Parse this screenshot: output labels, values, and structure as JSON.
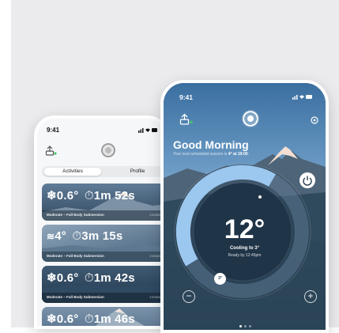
{
  "back_phone": {
    "status_time": "9:41",
    "tabs": [
      "Activities",
      "Profile"
    ],
    "cards": [
      {
        "value_temp": "0.6°",
        "value_time": "1m 52s",
        "subtitle": "Moderate – Full Body Submersion",
        "date": "17/03/2024",
        "mode_icon": "snowflake-icon"
      },
      {
        "value_temp": "4°",
        "value_time": "3m 15s",
        "subtitle": "Moderate – Full Body Submersion",
        "date": "17/03/2024",
        "mode_icon": "waves-icon"
      },
      {
        "value_temp": "0.6°",
        "value_time": "1m 42s",
        "subtitle": "Moderate – Full Body Submersion",
        "date": "17/03/2024",
        "mode_icon": "snowflake-icon"
      },
      {
        "value_temp": "0.6°",
        "value_time": "1m 46s",
        "subtitle": "",
        "date": "",
        "mode_icon": "snowflake-icon"
      }
    ]
  },
  "front_phone": {
    "status_time": "9:41",
    "greeting": "Good Morning",
    "subline_prefix": "Your next scheduled session is ",
    "subline_value": "4° at 19:00",
    "subline_suffix": ".",
    "temperature": "12°",
    "cooling_label": "Cooling to 3°",
    "ready_label": "Ready by 12:45pm",
    "handle_label": "3°",
    "minus_label": "−",
    "plus_label": "+",
    "progress_fraction": 0.42
  },
  "colors": {
    "accent_ring": "#9cc7ef",
    "device_online": "#43c463",
    "backdrop": "#ebebed"
  }
}
